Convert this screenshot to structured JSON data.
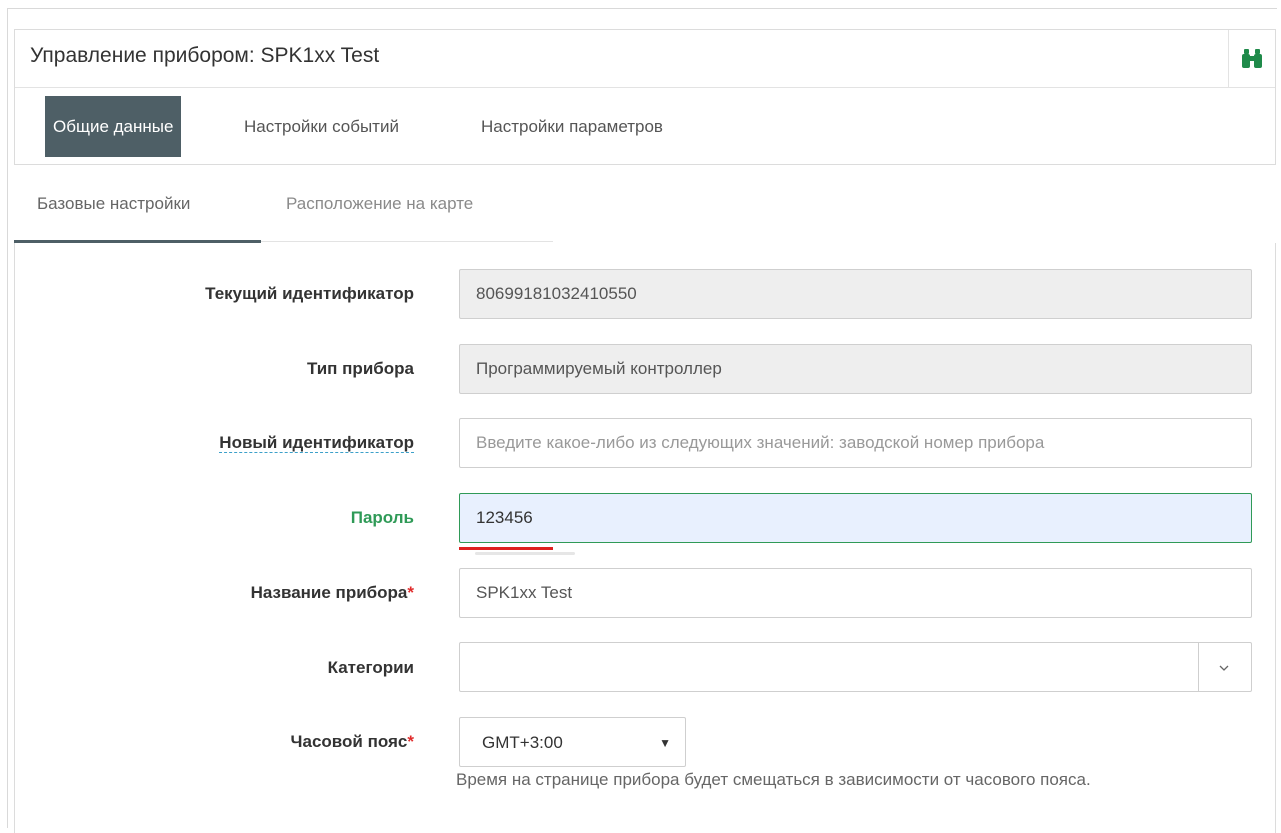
{
  "header": {
    "title": "Управление прибором: SPK1xx Test",
    "nav": [
      "Общие данные",
      "Настройки событий",
      "Настройки параметров"
    ]
  },
  "subtabs": [
    "Базовые настройки",
    "Расположение на карте"
  ],
  "form": {
    "current_id_label": "Текущий идентификатор",
    "current_id_value": "80699181032410550",
    "device_type_label": "Тип прибора",
    "device_type_value": "Программируемый контроллер",
    "new_id_label": "Новый идентификатор",
    "new_id_placeholder": "Введите какое-либо из следующих значений: заводской номер прибора",
    "password_label": "Пароль",
    "password_value": "123456",
    "name_label": "Название прибора",
    "name_value": "SPK1xx Test",
    "categories_label": "Категории",
    "categories_value": "",
    "timezone_label": "Часовой пояс",
    "timezone_value": "GMT+3:00",
    "timezone_help": "Время на странице прибора будет смещаться в зависимости от часового пояса.",
    "required_mark": "*"
  },
  "icons": {
    "binoculars": "binoculars-icon",
    "chevron": "chevron-down-icon"
  },
  "colors": {
    "nav_active": "#4e5f66",
    "green": "#2f9a57",
    "required": "#e02b2b",
    "binoculars": "#1f8a4a"
  }
}
